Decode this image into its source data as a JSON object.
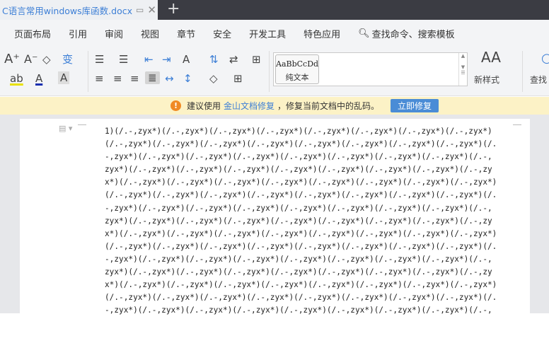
{
  "tab": {
    "title": "C语言常用windows库函数.docx",
    "new_tab": "+"
  },
  "menu": [
    "页面布局",
    "引用",
    "审阅",
    "视图",
    "章节",
    "安全",
    "开发工具",
    "特色应用"
  ],
  "search": "查找命令、搜索模板",
  "styles": {
    "preview": "AaBbCcDd",
    "name": "纯文本",
    "new_style": "新样式",
    "find": "查找"
  },
  "notice": {
    "prefix": "建议使用",
    "link": "金山文档修复",
    "suffix": "，修复当前文档中的乱码。",
    "button": "立即修复"
  },
  "document": {
    "lines": [
      "1)(/.-,zyx*)(/.-,zyx*)(/.-,zyx*)(/.-,zyx*)(/.-,zyx*)(/.-,zyx*)(/.-,zyx*)(/.-,zyx*)",
      "(/.-,zyx*)(/.-,zyx*)(/.-,zyx*)(/.-,zyx*)(/.-,zyx*)(/.-,zyx*)(/.-,zyx*)(/.-,zyx*)(/.",
      "-,zyx*)(/.-,zyx*)(/.-,zyx*)(/.-,zyx*)(/.-,zyx*)(/.-,zyx*)(/.-,zyx*)(/.-,zyx*)(/.-,",
      "zyx*)(/.-,zyx*)(/.-,zyx*)(/.-,zyx*)(/.-,zyx*)(/.-,zyx*)(/.-,zyx*)(/.-,zyx*)(/.-,zy",
      "x*)(/.-,zyx*)(/.-,zyx*)(/.-,zyx*)(/.-,zyx*)(/.-,zyx*)(/.-,zyx*)(/.-,zyx*)(/.-,zyx*)",
      "(/.-,zyx*)(/.-,zyx*)(/.-,zyx*)(/.-,zyx*)(/.-,zyx*)(/.-,zyx*)(/.-,zyx*)(/.-,zyx*)(/.",
      "-,zyx*)(/.-,zyx*)(/.-,zyx*)(/.-,zyx*)(/.-,zyx*)(/.-,zyx*)(/.-,zyx*)(/.-,zyx*)(/.-,",
      "zyx*)(/.-,zyx*)(/.-,zyx*)(/.-,zyx*)(/.-,zyx*)(/.-,zyx*)(/.-,zyx*)(/.-,zyx*)(/.-,zy",
      "x*)(/.-,zyx*)(/.-,zyx*)(/.-,zyx*)(/.-,zyx*)(/.-,zyx*)(/.-,zyx*)(/.-,zyx*)(/.-,zyx*)",
      "(/.-,zyx*)(/.-,zyx*)(/.-,zyx*)(/.-,zyx*)(/.-,zyx*)(/.-,zyx*)(/.-,zyx*)(/.-,zyx*)(/.",
      "-,zyx*)(/.-,zyx*)(/.-,zyx*)(/.-,zyx*)(/.-,zyx*)(/.-,zyx*)(/.-,zyx*)(/.-,zyx*)(/.-,",
      "zyx*)(/.-,zyx*)(/.-,zyx*)(/.-,zyx*)(/.-,zyx*)(/.-,zyx*)(/.-,zyx*)(/.-,zyx*)(/.-,zy",
      "x*)(/.-,zyx*)(/.-,zyx*)(/.-,zyx*)(/.-,zyx*)(/.-,zyx*)(/.-,zyx*)(/.-,zyx*)(/.-,zyx*)",
      "(/.-,zyx*)(/.-,zyx*)(/.-,zyx*)(/.-,zyx*)(/.-,zyx*)(/.-,zyx*)(/.-,zyx*)(/.-,zyx*)(/.",
      "-,zyx*)(/.-,zyx*)(/.-,zyx*)(/.-,zyx*)(/.-,zyx*)(/.-,zyx*)(/.-,zyx*)(/.-,zyx*)(/.-,"
    ]
  },
  "colors": {
    "accent": "#3d7fd6",
    "notice_bg": "#fcf2c6",
    "tabbar": "#3b3c43"
  }
}
